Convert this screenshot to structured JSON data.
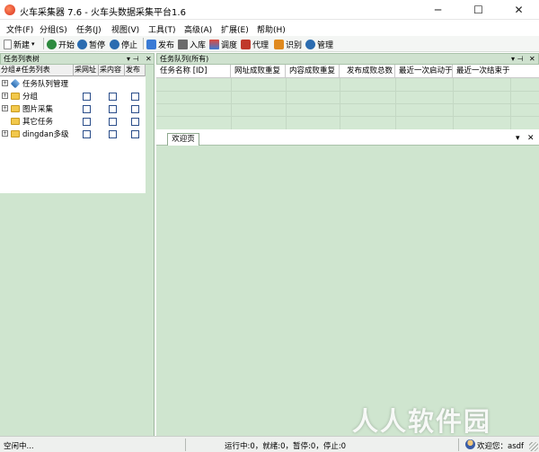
{
  "window": {
    "title": "火车采集器 7.6 - 火车头数据采集平台1.6",
    "minimize": "─",
    "maximize": "☐",
    "close": "✕"
  },
  "menu": [
    "文件(F)",
    "分组(S)",
    "任务(J)",
    "视图(V)",
    "工具(T)",
    "高级(A)",
    "扩展(E)",
    "帮助(H)"
  ],
  "toolbar": {
    "new": "新建",
    "start": "开始",
    "pause": "暂停",
    "stop": "停止",
    "publish": "发布",
    "import": "入库",
    "debug": "调度",
    "proxy": "代理",
    "recognize": "识别",
    "manage": "管理"
  },
  "left_panel": {
    "title": "任务列表树",
    "pin": "▾ ⊣",
    "close": "✕",
    "headers": [
      "分组#任务列表",
      "采网址",
      "采内容",
      "发布"
    ],
    "rows": [
      {
        "label": "任务队列管理",
        "expander": "+",
        "kind": "task",
        "has_checks": false
      },
      {
        "label": "分组",
        "expander": "+",
        "kind": "folder",
        "has_checks": true
      },
      {
        "label": "图片采集",
        "expander": "+",
        "kind": "folder",
        "has_checks": true
      },
      {
        "label": "其它任务",
        "expander": "",
        "kind": "folder",
        "has_checks": true
      },
      {
        "label": "dingdan多级",
        "expander": "+",
        "kind": "folder",
        "has_checks": true
      }
    ]
  },
  "queue_panel": {
    "title": "任务队列(所有)",
    "pin": "▾ ⊣",
    "close": "✕",
    "columns": [
      "任务名称 [ID]",
      "网址成败重复",
      "内容成败重复",
      "发布成败总数",
      "最近一次启动于",
      "最近一次结束于"
    ]
  },
  "welcome": {
    "tab": "欢迎页",
    "menu": "▾",
    "close": "✕"
  },
  "status": {
    "left": "空闲中...",
    "counts": "运行中:0，就绪:0，暂停:0，停止:0",
    "user": "欢迎您：asdf"
  },
  "watermark": "人人软件园",
  "colors": {
    "panel_bg": "#cfe5cf",
    "accent": "#2b6cb0"
  }
}
